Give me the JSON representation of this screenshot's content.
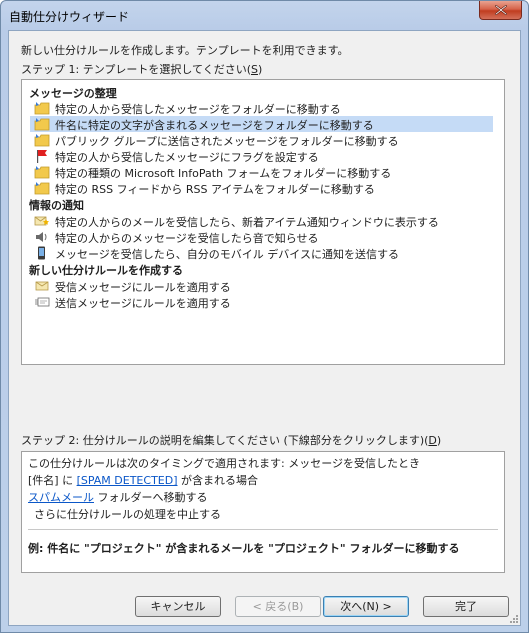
{
  "window": {
    "title": "自動仕分けウィザード"
  },
  "intro_text": "新しい仕分けルールを作成します。テンプレートを利用できます。",
  "step1": {
    "label": "ステップ 1: テンプレートを選択してください(",
    "accel": "S",
    "suffix": ")"
  },
  "templates": {
    "groups": [
      {
        "header": "メッセージの整理",
        "items": [
          {
            "label": "特定の人から受信したメッセージをフォルダーに移動する",
            "icon": "folder-move-icon"
          },
          {
            "label": "件名に特定の文字が含まれるメッセージをフォルダーに移動する",
            "icon": "folder-move-icon",
            "selected": true
          },
          {
            "label": "パブリック グループに送信されたメッセージをフォルダーに移動する",
            "icon": "folder-move-icon"
          },
          {
            "label": "特定の人から受信したメッセージにフラグを設定する",
            "icon": "flag-icon"
          },
          {
            "label": "特定の種類の Microsoft InfoPath フォームをフォルダーに移動する",
            "icon": "folder-move-icon"
          },
          {
            "label": "特定の RSS フィードから RSS アイテムをフォルダーに移動する",
            "icon": "folder-move-icon"
          }
        ]
      },
      {
        "header": "情報の通知",
        "items": [
          {
            "label": "特定の人からのメールを受信したら、新着アイテム通知ウィンドウに表示する",
            "icon": "new-mail-alert-icon"
          },
          {
            "label": "特定の人からのメッセージを受信したら音で知らせる",
            "icon": "speaker-icon"
          },
          {
            "label": "メッセージを受信したら、自分のモバイル デバイスに通知を送信する",
            "icon": "mobile-device-icon"
          }
        ]
      },
      {
        "header": "新しい仕分けルールを作成する",
        "items": [
          {
            "label": "受信メッセージにルールを適用する",
            "icon": "incoming-mail-icon"
          },
          {
            "label": "送信メッセージにルールを適用する",
            "icon": "outgoing-mail-icon"
          }
        ]
      }
    ]
  },
  "step2": {
    "label": "ステップ 2: 仕分けルールの説明を編集してください (下線部分をクリックします)(",
    "accel": "D",
    "suffix": ")"
  },
  "description": {
    "line1": "この仕分けルールは次のタイミングで適用されます: メッセージを受信したとき",
    "line2_prefix": "[件名] に ",
    "line2_link": "[SPAM DETECTED]",
    "line2_suffix": " が含まれる場合",
    "line3_link": "スパムメール",
    "line3_suffix": " フォルダーへ移動する",
    "line4": "さらに仕分けルールの処理を中止する",
    "example": "例: 件名に \"プロジェクト\" が含まれるメールを \"プロジェクト\" フォルダーに移動する"
  },
  "buttons": {
    "cancel": "キャンセル",
    "back": "< 戻る(B)",
    "next": "次へ(N) >",
    "finish": "完了"
  },
  "colors": {
    "selection": "#c5dbf6",
    "link": "#0b57c8"
  }
}
